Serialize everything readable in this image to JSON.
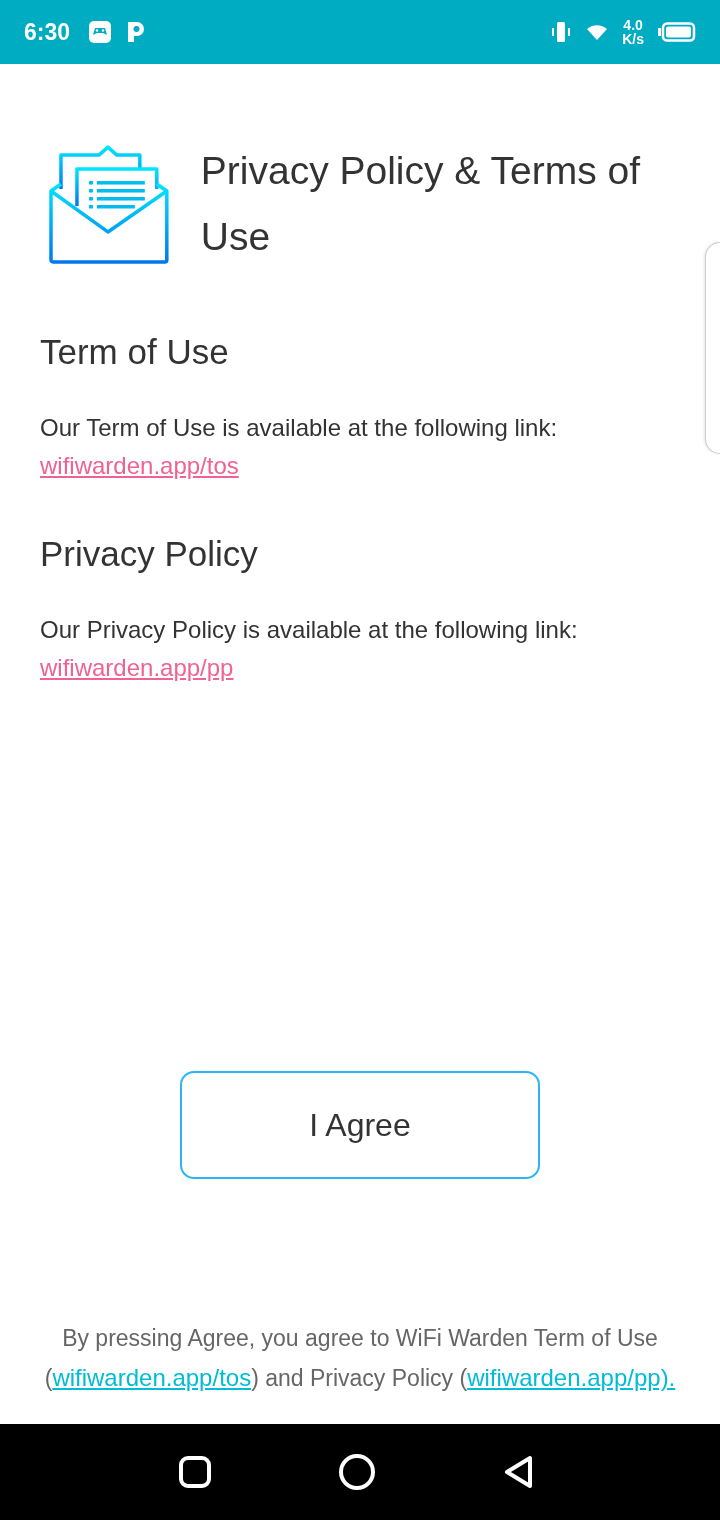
{
  "status_bar": {
    "time": "6:30",
    "speed_value": "4.0",
    "speed_unit": "K/s"
  },
  "title": "Privacy Policy & Terms of Use",
  "sections": [
    {
      "heading": "Term of Use",
      "text": "Our Term of Use is available at the following link:",
      "link": "wifiwarden.app/tos"
    },
    {
      "heading": "Privacy Policy",
      "text": "Our Privacy Policy is available at the following link:",
      "link": "wifiwarden.app/pp"
    }
  ],
  "agree_button": "I Agree",
  "footer": [
    {
      "kind": "text",
      "text": "By pressing Agree, you agree to WiFi Warden Term of Use ("
    },
    {
      "kind": "link",
      "text": "wifiwarden.app/tos"
    },
    {
      "kind": "text",
      "text": ") and Privacy Policy ("
    },
    {
      "kind": "link",
      "text": "wifiwarden.app/pp)."
    }
  ]
}
